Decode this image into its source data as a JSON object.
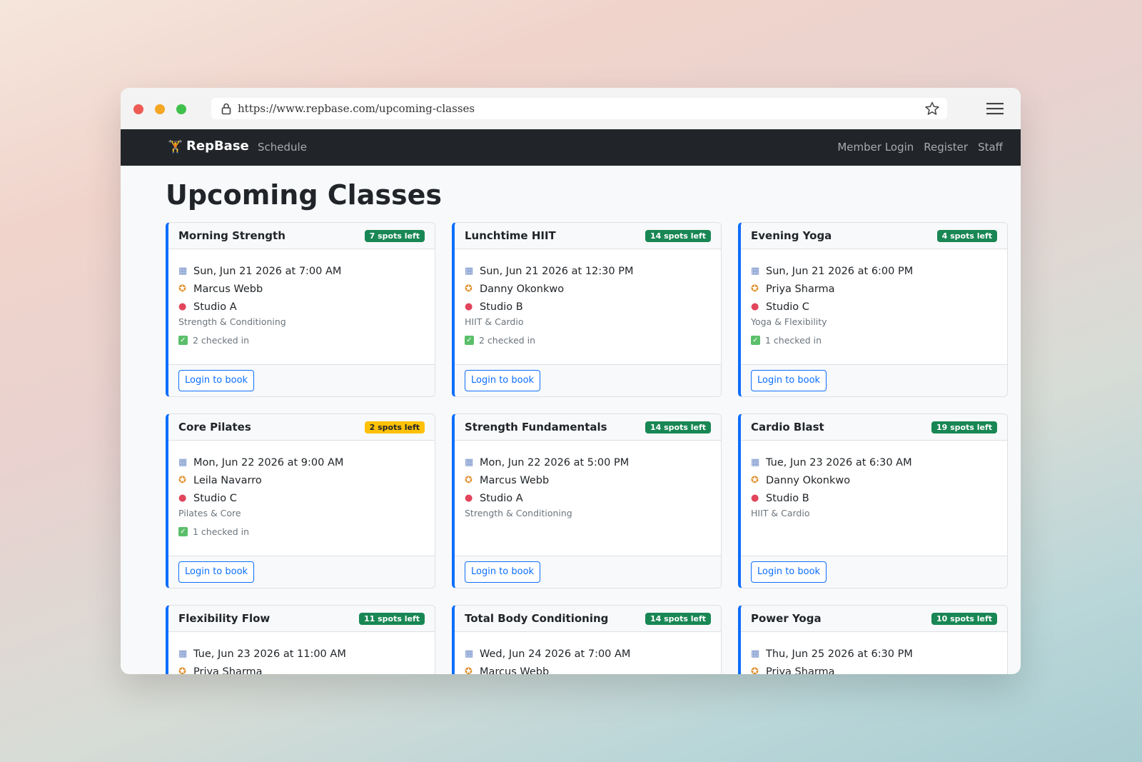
{
  "browser": {
    "url": "https://www.repbase.com/upcoming-classes"
  },
  "navbar": {
    "brand": "RepBase",
    "brand_icon": "🏋",
    "links_left": [
      "Schedule"
    ],
    "links_right": [
      "Member Login",
      "Register",
      "Staff"
    ]
  },
  "page": {
    "title": "Upcoming Classes"
  },
  "colors": {
    "accent": "#0d6efd",
    "badge_ok": "#198754",
    "badge_warn": "#ffc107",
    "navbar": "#212529"
  },
  "classes": [
    {
      "name": "Morning Strength",
      "spots": "7 spots left",
      "status": "ok",
      "datetime": "Sun, Jun 21 2026 at 7:00 AM",
      "instructor": "Marcus Webb",
      "studio": "Studio A",
      "category": "Strength & Conditioning",
      "checked_in": "2 checked in",
      "button": "Login to book"
    },
    {
      "name": "Lunchtime HIIT",
      "spots": "14 spots left",
      "status": "ok",
      "datetime": "Sun, Jun 21 2026 at 12:30 PM",
      "instructor": "Danny Okonkwo",
      "studio": "Studio B",
      "category": "HIIT & Cardio",
      "checked_in": "2 checked in",
      "button": "Login to book"
    },
    {
      "name": "Evening Yoga",
      "spots": "4 spots left",
      "status": "ok",
      "datetime": "Sun, Jun 21 2026 at 6:00 PM",
      "instructor": "Priya Sharma",
      "studio": "Studio C",
      "category": "Yoga & Flexibility",
      "checked_in": "1 checked in",
      "button": "Login to book"
    },
    {
      "name": "Core Pilates",
      "spots": "2 spots left",
      "status": "warn",
      "datetime": "Mon, Jun 22 2026 at 9:00 AM",
      "instructor": "Leila Navarro",
      "studio": "Studio C",
      "category": "Pilates & Core",
      "checked_in": "1 checked in",
      "button": "Login to book"
    },
    {
      "name": "Strength Fundamentals",
      "spots": "14 spots left",
      "status": "ok",
      "datetime": "Mon, Jun 22 2026 at 5:00 PM",
      "instructor": "Marcus Webb",
      "studio": "Studio A",
      "category": "Strength & Conditioning",
      "checked_in": "",
      "button": "Login to book"
    },
    {
      "name": "Cardio Blast",
      "spots": "19 spots left",
      "status": "ok",
      "datetime": "Tue, Jun 23 2026 at 6:30 AM",
      "instructor": "Danny Okonkwo",
      "studio": "Studio B",
      "category": "HIIT & Cardio",
      "checked_in": "",
      "button": "Login to book"
    },
    {
      "name": "Flexibility Flow",
      "spots": "11 spots left",
      "status": "ok",
      "datetime": "Tue, Jun 23 2026 at 11:00 AM",
      "instructor": "Priya Sharma",
      "studio": "",
      "category": "",
      "checked_in": "",
      "button": ""
    },
    {
      "name": "Total Body Conditioning",
      "spots": "14 spots left",
      "status": "ok",
      "datetime": "Wed, Jun 24 2026 at 7:00 AM",
      "instructor": "Marcus Webb",
      "studio": "",
      "category": "",
      "checked_in": "",
      "button": ""
    },
    {
      "name": "Power Yoga",
      "spots": "10 spots left",
      "status": "ok",
      "datetime": "Thu, Jun 25 2026 at 6:30 PM",
      "instructor": "Priya Sharma",
      "studio": "",
      "category": "",
      "checked_in": "",
      "button": ""
    }
  ]
}
